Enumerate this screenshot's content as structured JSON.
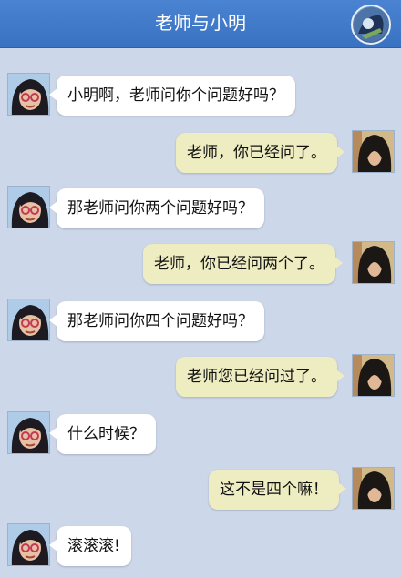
{
  "header": {
    "title": "老师与小明"
  },
  "messages": [
    {
      "sender": "teacher",
      "text": "小明啊，老师问你个问题好吗？"
    },
    {
      "sender": "student",
      "text": "老师，你已经问了。"
    },
    {
      "sender": "teacher",
      "text": "那老师问你两个问题好吗？"
    },
    {
      "sender": "student",
      "text": "老师，你已经问两个了。"
    },
    {
      "sender": "teacher",
      "text": "那老师问你四个问题好吗？"
    },
    {
      "sender": "student",
      "text": "老师您已经问过了。"
    },
    {
      "sender": "teacher",
      "text": "什么时候？"
    },
    {
      "sender": "student",
      "text": "这不是四个嘛！"
    },
    {
      "sender": "teacher",
      "text": "滚滚滚!"
    }
  ],
  "colors": {
    "header": "#3f78c8",
    "background": "#ccd7ea",
    "teacher_bubble": "#ffffff",
    "student_bubble": "#eeecc1"
  }
}
